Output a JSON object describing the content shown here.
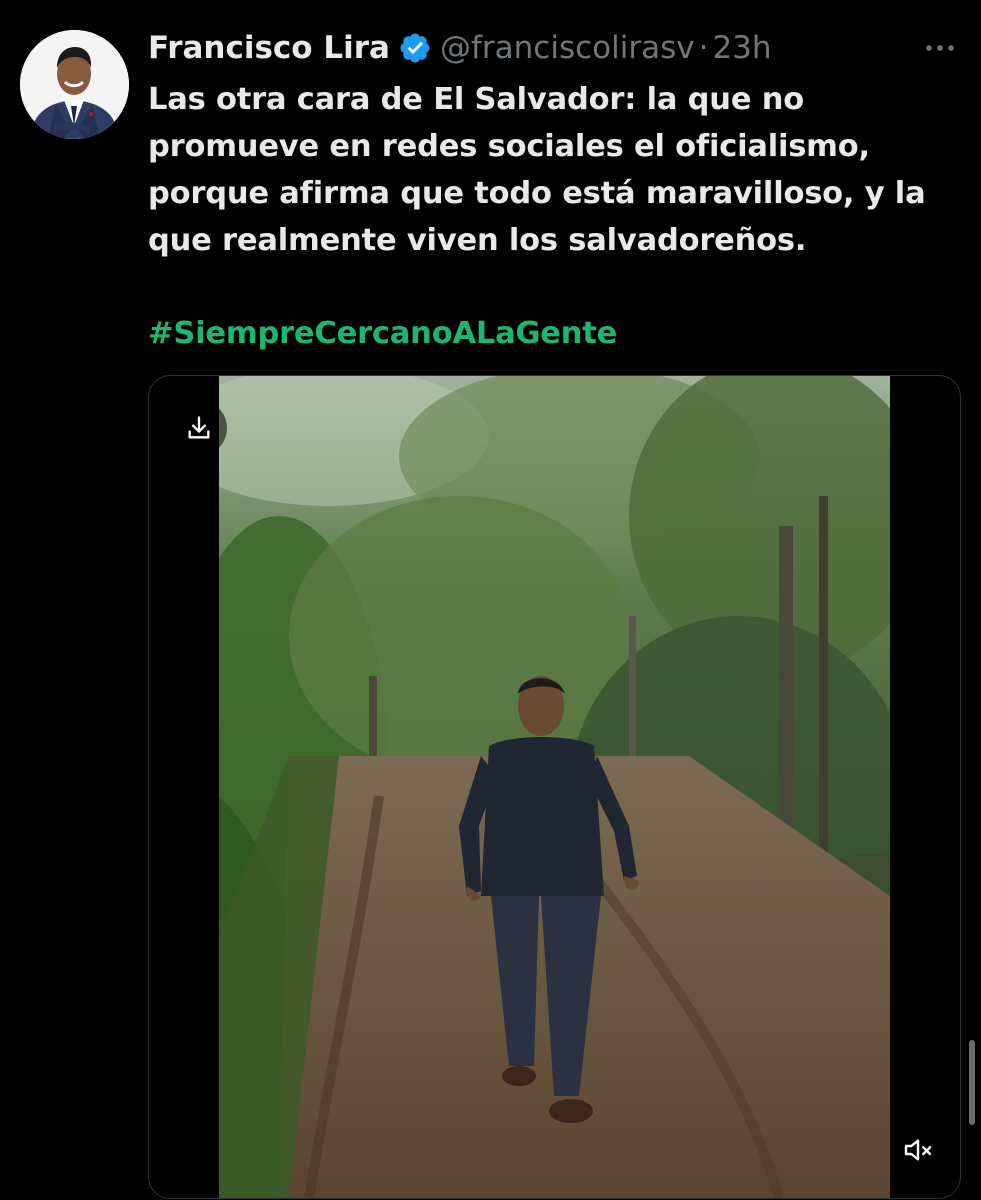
{
  "tweet": {
    "display_name": "Francisco Lira",
    "handle": "@franciscolirasv",
    "separator": "·",
    "timestamp": "23h",
    "text": "Las otra cara de El Salvador: la que no\npromueve en redes sociales el oficialismo,\nporque afirma que todo está maravilloso, y la\nque realmente viven los salvadoreños.",
    "hashtag": "#SiempreCercanoALaGente"
  },
  "icons": {
    "verified": "verified-badge-icon",
    "more": "more-options-icon",
    "download": "download-icon",
    "mute": "volume-muted-icon"
  },
  "colors": {
    "background": "#000000",
    "text": "#e7e9ea",
    "secondary_text": "#71767b",
    "hashtag": "#1bb76e",
    "verified": "#1d9bf0",
    "border": "#2f3336"
  }
}
